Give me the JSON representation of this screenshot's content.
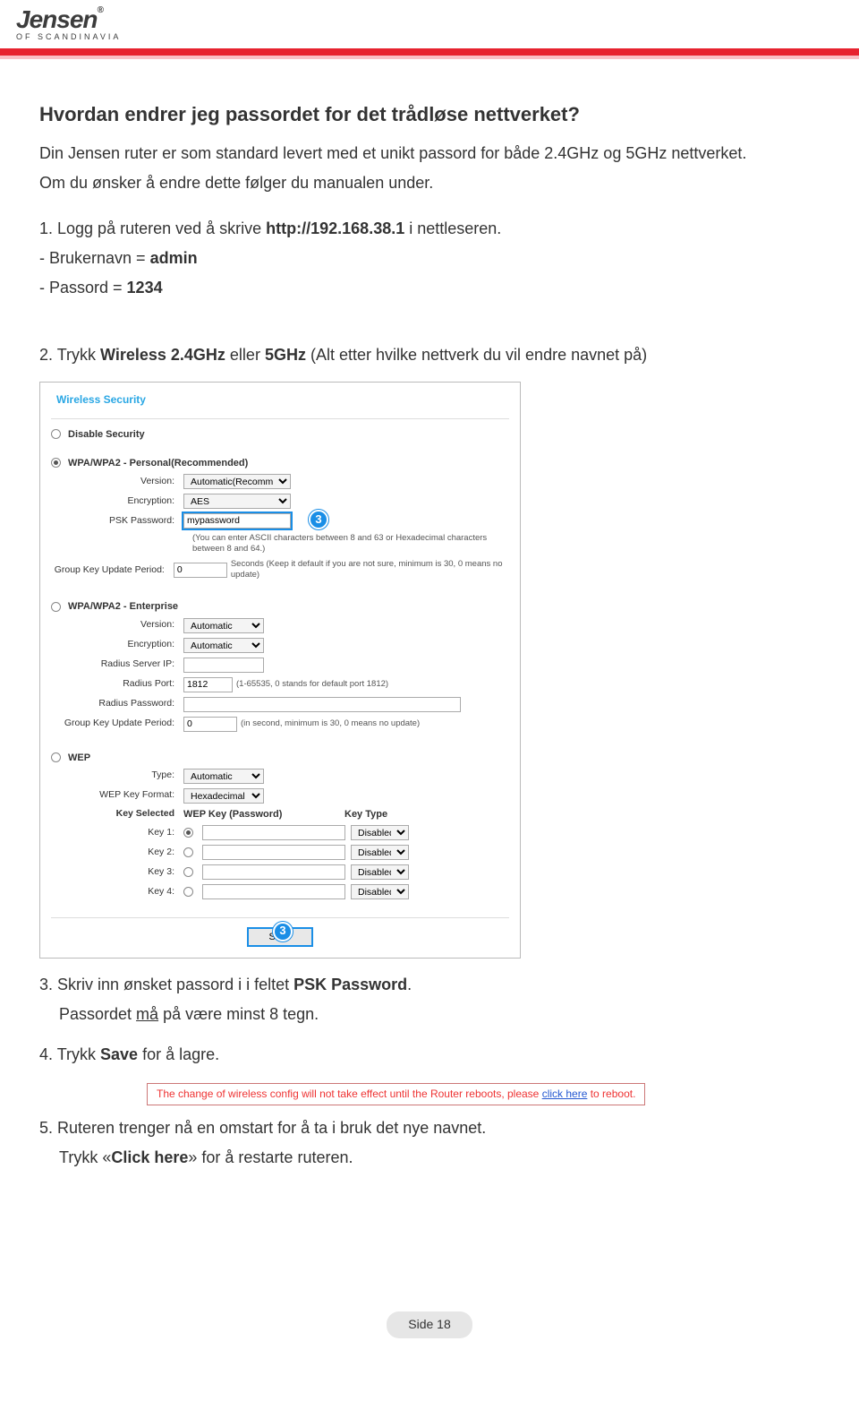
{
  "brand": {
    "name": "Jensen",
    "tag": "OF SCANDINAVIA"
  },
  "heading": "Hvordan endrer jeg passordet for det trådløse nettverket?",
  "intro_l1": "Din Jensen ruter er som standard levert med et unikt passord for både 2.4GHz og 5GHz nettverket.",
  "intro_l2": "Om du ønsker å endre dette følger du manualen under.",
  "step1_a": "1. Logg på ruteren ved å skrive ",
  "step1_url": "http://192.168.38.1",
  "step1_b": " i nettleseren.",
  "step1_user": "- Brukernavn = ",
  "step1_user_v": "admin",
  "step1_pass": "- Passord = ",
  "step1_pass_v": "1234",
  "step2_a": "2. Trykk ",
  "step2_w1": "Wireless 2.4GHz",
  "step2_mid": " eller ",
  "step2_w2": "5GHz",
  "step2_b": " (Alt etter hvilke nettverk du vil endre navnet på)",
  "panel": {
    "title": "Wireless Security",
    "disable": "Disable Security",
    "wpa_pers": "WPA/WPA2 - Personal(Recommended)",
    "version": "Version:",
    "version_v": "Automatic(Recommended)",
    "enc": "Encryption:",
    "enc_v": "AES",
    "psk": "PSK Password:",
    "psk_v": "mypassword",
    "psk_note": "(You can enter ASCII characters between 8 and 63 or Hexadecimal characters between 8 and 64.)",
    "gku": "Group Key Update Period:",
    "gku_v": "0",
    "gku_note": "Seconds (Keep it default if you are not sure, minimum is 30, 0 means no update)",
    "wpa_ent": "WPA/WPA2 - Enterprise",
    "ent_version_v": "Automatic",
    "ent_enc_v": "Automatic",
    "rad_ip": "Radius Server IP:",
    "rad_port": "Radius Port:",
    "rad_port_v": "1812",
    "rad_port_note": "(1-65535, 0 stands for default port 1812)",
    "rad_pw": "Radius Password:",
    "ent_gku_v": "0",
    "ent_gku_note": "(in second, minimum is 30, 0 means no update)",
    "wep": "WEP",
    "type": "Type:",
    "type_v": "Automatic",
    "keyfmt": "WEP Key Format:",
    "keyfmt_v": "Hexadecimal",
    "key_sel": "Key Selected",
    "key_pw": "WEP Key (Password)",
    "key_type": "Key Type",
    "k1": "Key 1:",
    "k2": "Key 2:",
    "k3": "Key 3:",
    "k4": "Key 4:",
    "disabled": "Disabled",
    "save": "Save",
    "callout": "3"
  },
  "step3_a": "3. Skriv inn ønsket passord i i feltet ",
  "step3_b": "PSK Password",
  "step3_c": ".",
  "step3_d": "Passordet ",
  "step3_u": "må",
  "step3_e": " på være minst 8 tegn.",
  "step4_a": "4. Trykk ",
  "step4_b": "Save",
  "step4_c": " for å lagre.",
  "info_a": "The change of wireless config will not take effect until the Router reboots, please ",
  "info_link": "click here",
  "info_b": " to reboot.",
  "step5_a": "5. Ruteren trenger nå en omstart for å ta i bruk det nye navnet.",
  "step5_b": "Trykk «",
  "step5_c": "Click here",
  "step5_d": "» for å restarte ruteren.",
  "pagenum": "Side 18"
}
